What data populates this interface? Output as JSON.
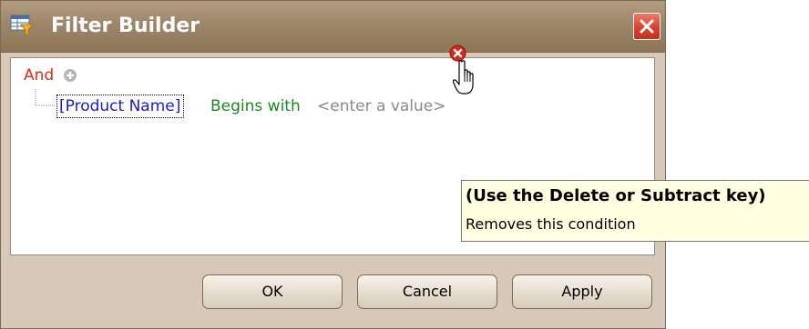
{
  "window": {
    "title": "Filter Builder",
    "icon": "filter-table-icon",
    "close_icon": "close-icon"
  },
  "filter": {
    "group_operator": "And",
    "add_icon": "add-condition-icon",
    "condition": {
      "field": "[Product Name]",
      "operation": "Begins with",
      "value_placeholder": "<enter a value>",
      "remove_icon": "remove-condition-icon"
    }
  },
  "cursor": "hand-pointer-icon",
  "tooltip": {
    "title": "(Use the Delete or Subtract key)",
    "text": "Removes this condition"
  },
  "buttons": {
    "ok": "OK",
    "cancel": "Cancel",
    "apply": "Apply"
  },
  "colors": {
    "group_operator": "#e8261c",
    "field": "#1a1ad6",
    "operation": "#1e8a1e",
    "value": "#8a8a8a",
    "title_bar": "#9e8668",
    "close_button": "#d9412d",
    "tooltip_bg": "#ffffe1"
  }
}
